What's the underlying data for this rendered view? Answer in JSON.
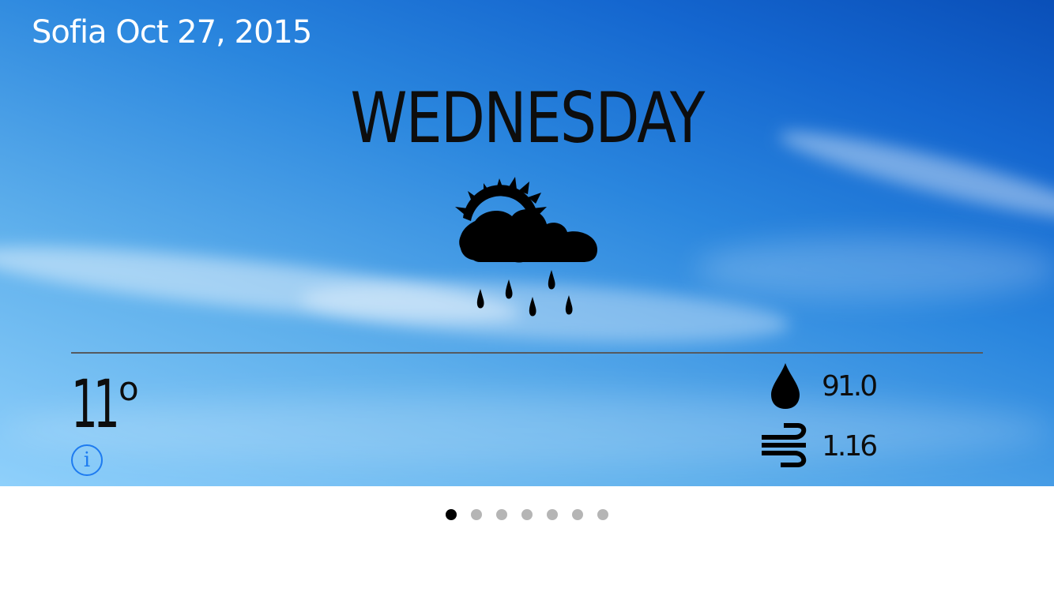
{
  "header": {
    "location_date": "Sofia Oct 27, 2015"
  },
  "forecast": {
    "day": "WEDNESDAY",
    "condition_icon": "sun-cloud-rain-icon",
    "temperature": "11",
    "temperature_unit": "o",
    "humidity": "91.0",
    "wind": "1.16"
  },
  "info_button": {
    "label": "i"
  },
  "pager": {
    "count": 7,
    "active_index": 0
  },
  "colors": {
    "sky_top": "#0a4fb8",
    "sky_bottom": "#8fd0fb",
    "info_blue": "#1e7bf0",
    "dot_active": "#000000",
    "dot_inactive": "#b5b5b5"
  }
}
